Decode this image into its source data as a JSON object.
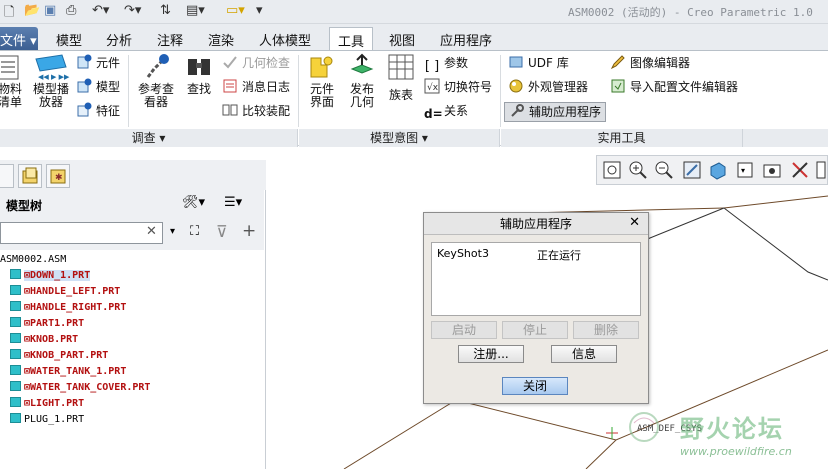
{
  "window_title": "ASM0002 (活动的) - Creo Parametric 1.0",
  "tabs": [
    "文件",
    "模型",
    "分析",
    "注释",
    "渲染",
    "人体模型",
    "工具",
    "视图",
    "应用程序"
  ],
  "ribbon": {
    "investigate": {
      "footer": "调查",
      "bom_1": "物料",
      "bom_2": "清单",
      "player_1": "模型播",
      "player_2": "放器",
      "component": "元件",
      "model": "模型",
      "feature": "特征",
      "refviewer_1": "参考查",
      "refviewer_2": "看器",
      "find": "查找",
      "geomcheck": "几何检查",
      "msglog": "消息日志",
      "compare": "比较装配"
    },
    "intent": {
      "footer": "模型意图",
      "compint_1": "元件",
      "compint_2": "界面",
      "pubgeom_1": "发布",
      "pubgeom_2": "几何",
      "family": "族表",
      "params": "参数",
      "switchsym": "切换符号",
      "relations": "关系"
    },
    "utilities": {
      "footer": "实用工具",
      "udf": "UDF 库",
      "appearance": "外观管理器",
      "auxapp": "辅助应用程序",
      "imgedit": "图像编辑器",
      "cfgedit": "导入配置文件编辑器"
    }
  },
  "navigator": {
    "title": "模型树",
    "search_placeholder": "",
    "tree": [
      {
        "label": "ASM0002.ASM",
        "style": "root"
      },
      {
        "label": "⊠DOWN_1.PRT",
        "style": "red-sel"
      },
      {
        "label": "⊠HANDLE_LEFT.PRT",
        "style": "red"
      },
      {
        "label": "⊠HANDLE_RIGHT.PRT",
        "style": "red"
      },
      {
        "label": "⊠PART1.PRT",
        "style": "red"
      },
      {
        "label": "⊠KNOB.PRT",
        "style": "red"
      },
      {
        "label": "⊠KNOB_PART.PRT",
        "style": "red"
      },
      {
        "label": "⊠WATER_TANK_1.PRT",
        "style": "red"
      },
      {
        "label": "⊠WATER_TANK_COVER.PRT",
        "style": "red"
      },
      {
        "label": "⊠LIGHT.PRT",
        "style": "red"
      },
      {
        "label": "PLUG_1.PRT",
        "style": "plain"
      }
    ]
  },
  "dialog": {
    "title": "辅助应用程序",
    "apps": [
      {
        "name": "KeyShot3",
        "status": "正在运行"
      }
    ],
    "start": "启动",
    "stop": "停止",
    "delete": "删除",
    "register": "注册...",
    "info": "信息",
    "close": "关闭"
  },
  "canvas": {
    "csys_label": "ASM_DEF_CSYS"
  },
  "watermark": {
    "text": "野火论坛",
    "url": "www.proewildfire.cn"
  },
  "colors": {
    "accent": "#3c5f92",
    "tree_red": "#b31010",
    "part_icon": "#2ebfc9"
  }
}
